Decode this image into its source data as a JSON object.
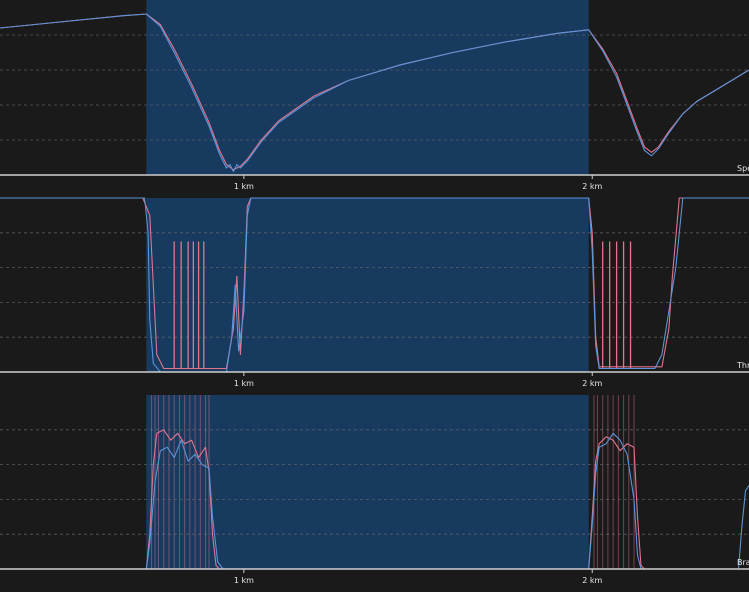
{
  "colors": {
    "background": "#1a1a1a",
    "highlight": "#173a5e",
    "series_a": "#e0758e",
    "series_b": "#5b93d8"
  },
  "chart_data": [
    {
      "type": "line",
      "panel": "speed",
      "panel_label": "Spe",
      "xlabel": "",
      "ylabel": "",
      "x_unit": "km",
      "xlim": [
        0.3,
        2.45
      ],
      "ylim": [
        0,
        1
      ],
      "x_ticks": [
        {
          "value": 1,
          "label": "1 km"
        },
        {
          "value": 2,
          "label": "2 km"
        }
      ],
      "y_gridlines": [
        0.2,
        0.4,
        0.6,
        0.8
      ],
      "highlight_range": [
        0.72,
        1.99
      ],
      "series": [
        {
          "color": "#e0758e",
          "points": [
            [
              0.3,
              0.84
            ],
            [
              0.5,
              0.88
            ],
            [
              0.65,
              0.91
            ],
            [
              0.72,
              0.92
            ],
            [
              0.76,
              0.86
            ],
            [
              0.8,
              0.72
            ],
            [
              0.85,
              0.52
            ],
            [
              0.9,
              0.3
            ],
            [
              0.93,
              0.14
            ],
            [
              0.95,
              0.06
            ],
            [
              0.97,
              0.03
            ],
            [
              0.99,
              0.05
            ],
            [
              1.01,
              0.09
            ],
            [
              1.05,
              0.2
            ],
            [
              1.1,
              0.31
            ],
            [
              1.2,
              0.45
            ],
            [
              1.3,
              0.54
            ],
            [
              1.45,
              0.63
            ],
            [
              1.6,
              0.7
            ],
            [
              1.75,
              0.76
            ],
            [
              1.9,
              0.81
            ],
            [
              1.99,
              0.83
            ],
            [
              2.03,
              0.72
            ],
            [
              2.07,
              0.58
            ],
            [
              2.1,
              0.42
            ],
            [
              2.13,
              0.26
            ],
            [
              2.15,
              0.16
            ],
            [
              2.17,
              0.13
            ],
            [
              2.19,
              0.16
            ],
            [
              2.22,
              0.25
            ],
            [
              2.26,
              0.35
            ],
            [
              2.3,
              0.42
            ],
            [
              2.35,
              0.48
            ],
            [
              2.4,
              0.54
            ],
            [
              2.45,
              0.6
            ]
          ]
        },
        {
          "color": "#5b93d8",
          "points": [
            [
              0.3,
              0.84
            ],
            [
              0.5,
              0.88
            ],
            [
              0.65,
              0.91
            ],
            [
              0.72,
              0.92
            ],
            [
              0.76,
              0.85
            ],
            [
              0.8,
              0.7
            ],
            [
              0.85,
              0.5
            ],
            [
              0.9,
              0.28
            ],
            [
              0.93,
              0.12
            ],
            [
              0.95,
              0.04
            ],
            [
              0.96,
              0.06
            ],
            [
              0.97,
              0.02
            ],
            [
              0.98,
              0.06
            ],
            [
              0.99,
              0.04
            ],
            [
              1.01,
              0.08
            ],
            [
              1.05,
              0.19
            ],
            [
              1.1,
              0.3
            ],
            [
              1.2,
              0.44
            ],
            [
              1.3,
              0.54
            ],
            [
              1.45,
              0.63
            ],
            [
              1.6,
              0.7
            ],
            [
              1.75,
              0.76
            ],
            [
              1.9,
              0.81
            ],
            [
              1.99,
              0.83
            ],
            [
              2.03,
              0.71
            ],
            [
              2.07,
              0.56
            ],
            [
              2.1,
              0.4
            ],
            [
              2.13,
              0.24
            ],
            [
              2.15,
              0.14
            ],
            [
              2.17,
              0.11
            ],
            [
              2.19,
              0.15
            ],
            [
              2.22,
              0.24
            ],
            [
              2.26,
              0.35
            ],
            [
              2.3,
              0.42
            ],
            [
              2.35,
              0.48
            ],
            [
              2.4,
              0.54
            ],
            [
              2.45,
              0.6
            ]
          ]
        }
      ]
    },
    {
      "type": "line",
      "panel": "throttle",
      "panel_label": "Thro",
      "xlabel": "",
      "ylabel": "",
      "x_unit": "km",
      "xlim": [
        0.3,
        2.45
      ],
      "ylim": [
        0,
        1
      ],
      "x_ticks": [
        {
          "value": 1,
          "label": "1 km"
        },
        {
          "value": 2,
          "label": "2 km"
        }
      ],
      "y_gridlines": [
        0.2,
        0.4,
        0.6,
        0.8
      ],
      "highlight_range": [
        0.72,
        1.99
      ],
      "series": [
        {
          "color": "#e0758e",
          "points": [
            [
              0.3,
              1.0
            ],
            [
              0.71,
              1.0
            ],
            [
              0.73,
              0.9
            ],
            [
              0.74,
              0.5
            ],
            [
              0.75,
              0.1
            ],
            [
              0.77,
              0.02
            ],
            [
              0.95,
              0.02
            ],
            [
              0.97,
              0.25
            ],
            [
              0.98,
              0.55
            ],
            [
              0.99,
              0.1
            ],
            [
              1.0,
              0.45
            ],
            [
              1.01,
              0.95
            ],
            [
              1.02,
              1.0
            ],
            [
              1.99,
              1.0
            ],
            [
              2.0,
              0.8
            ],
            [
              2.01,
              0.2
            ],
            [
              2.02,
              0.03
            ],
            [
              2.2,
              0.03
            ],
            [
              2.22,
              0.25
            ],
            [
              2.23,
              0.55
            ],
            [
              2.25,
              1.0
            ],
            [
              2.45,
              1.0
            ]
          ]
        },
        {
          "color": "#5b93d8",
          "points": [
            [
              0.3,
              1.0
            ],
            [
              0.715,
              1.0
            ],
            [
              0.725,
              0.8
            ],
            [
              0.73,
              0.3
            ],
            [
              0.74,
              0.05
            ],
            [
              0.76,
              0.0
            ],
            [
              0.95,
              0.0
            ],
            [
              0.965,
              0.2
            ],
            [
              0.975,
              0.5
            ],
            [
              0.985,
              0.12
            ],
            [
              1.0,
              0.35
            ],
            [
              1.01,
              0.9
            ],
            [
              1.02,
              1.0
            ],
            [
              1.99,
              1.0
            ],
            [
              2.0,
              0.7
            ],
            [
              2.01,
              0.15
            ],
            [
              2.02,
              0.02
            ],
            [
              2.18,
              0.02
            ],
            [
              2.2,
              0.1
            ],
            [
              2.22,
              0.35
            ],
            [
              2.24,
              0.6
            ],
            [
              2.26,
              1.0
            ],
            [
              2.45,
              1.0
            ]
          ]
        }
      ],
      "spike_color": "#e0758e",
      "spikes": [
        {
          "x": 0.8,
          "top": 0.75
        },
        {
          "x": 0.82,
          "top": 0.75
        },
        {
          "x": 0.84,
          "top": 0.75
        },
        {
          "x": 0.855,
          "top": 0.75
        },
        {
          "x": 0.87,
          "top": 0.75
        },
        {
          "x": 0.885,
          "top": 0.75
        },
        {
          "x": 2.03,
          "top": 0.75
        },
        {
          "x": 2.05,
          "top": 0.75
        },
        {
          "x": 2.07,
          "top": 0.75
        },
        {
          "x": 2.09,
          "top": 0.75
        },
        {
          "x": 2.11,
          "top": 0.75
        }
      ]
    },
    {
      "type": "line",
      "panel": "brake",
      "panel_label": "Bra",
      "xlabel": "",
      "ylabel": "",
      "x_unit": "km",
      "xlim": [
        0.3,
        2.45
      ],
      "ylim": [
        0,
        1
      ],
      "x_ticks": [
        {
          "value": 1,
          "label": "1 km"
        },
        {
          "value": 2,
          "label": "2 km"
        }
      ],
      "y_gridlines": [
        0.2,
        0.4,
        0.6,
        0.8
      ],
      "highlight_range": [
        0.72,
        1.99
      ],
      "series": [
        {
          "color": "#e0758e",
          "points": [
            [
              0.3,
              0.0
            ],
            [
              0.72,
              0.0
            ],
            [
              0.73,
              0.2
            ],
            [
              0.74,
              0.6
            ],
            [
              0.75,
              0.78
            ],
            [
              0.77,
              0.8
            ],
            [
              0.79,
              0.74
            ],
            [
              0.81,
              0.78
            ],
            [
              0.83,
              0.72
            ],
            [
              0.85,
              0.74
            ],
            [
              0.87,
              0.64
            ],
            [
              0.89,
              0.7
            ],
            [
              0.9,
              0.56
            ],
            [
              0.91,
              0.2
            ],
            [
              0.92,
              0.02
            ],
            [
              0.93,
              0.0
            ],
            [
              1.99,
              0.0
            ],
            [
              2.0,
              0.3
            ],
            [
              2.01,
              0.62
            ],
            [
              2.02,
              0.72
            ],
            [
              2.04,
              0.76
            ],
            [
              2.06,
              0.74
            ],
            [
              2.08,
              0.68
            ],
            [
              2.1,
              0.72
            ],
            [
              2.12,
              0.7
            ],
            [
              2.13,
              0.3
            ],
            [
              2.14,
              0.02
            ],
            [
              2.15,
              0.0
            ],
            [
              2.45,
              0.0
            ]
          ]
        },
        {
          "color": "#5b93d8",
          "points": [
            [
              0.3,
              0.0
            ],
            [
              0.72,
              0.0
            ],
            [
              0.73,
              0.15
            ],
            [
              0.745,
              0.5
            ],
            [
              0.76,
              0.68
            ],
            [
              0.78,
              0.7
            ],
            [
              0.8,
              0.64
            ],
            [
              0.82,
              0.74
            ],
            [
              0.84,
              0.62
            ],
            [
              0.86,
              0.66
            ],
            [
              0.88,
              0.6
            ],
            [
              0.9,
              0.58
            ],
            [
              0.91,
              0.3
            ],
            [
              0.925,
              0.04
            ],
            [
              0.94,
              0.0
            ],
            [
              1.99,
              0.0
            ],
            [
              2.0,
              0.25
            ],
            [
              2.01,
              0.55
            ],
            [
              2.02,
              0.7
            ],
            [
              2.04,
              0.72
            ],
            [
              2.06,
              0.78
            ],
            [
              2.08,
              0.74
            ],
            [
              2.1,
              0.66
            ],
            [
              2.12,
              0.4
            ],
            [
              2.13,
              0.08
            ],
            [
              2.14,
              0.0
            ],
            [
              2.42,
              0.0
            ],
            [
              2.43,
              0.25
            ],
            [
              2.44,
              0.45
            ],
            [
              2.45,
              0.48
            ]
          ]
        }
      ],
      "strip_color": "#e0758e",
      "strips": [
        0.735,
        0.745,
        0.755,
        0.77,
        0.785,
        0.8,
        0.815,
        0.83,
        0.845,
        0.86,
        0.875,
        0.89,
        0.9,
        2.005,
        2.015,
        2.03,
        2.045,
        2.06,
        2.075,
        2.09,
        2.105,
        2.12
      ]
    }
  ]
}
